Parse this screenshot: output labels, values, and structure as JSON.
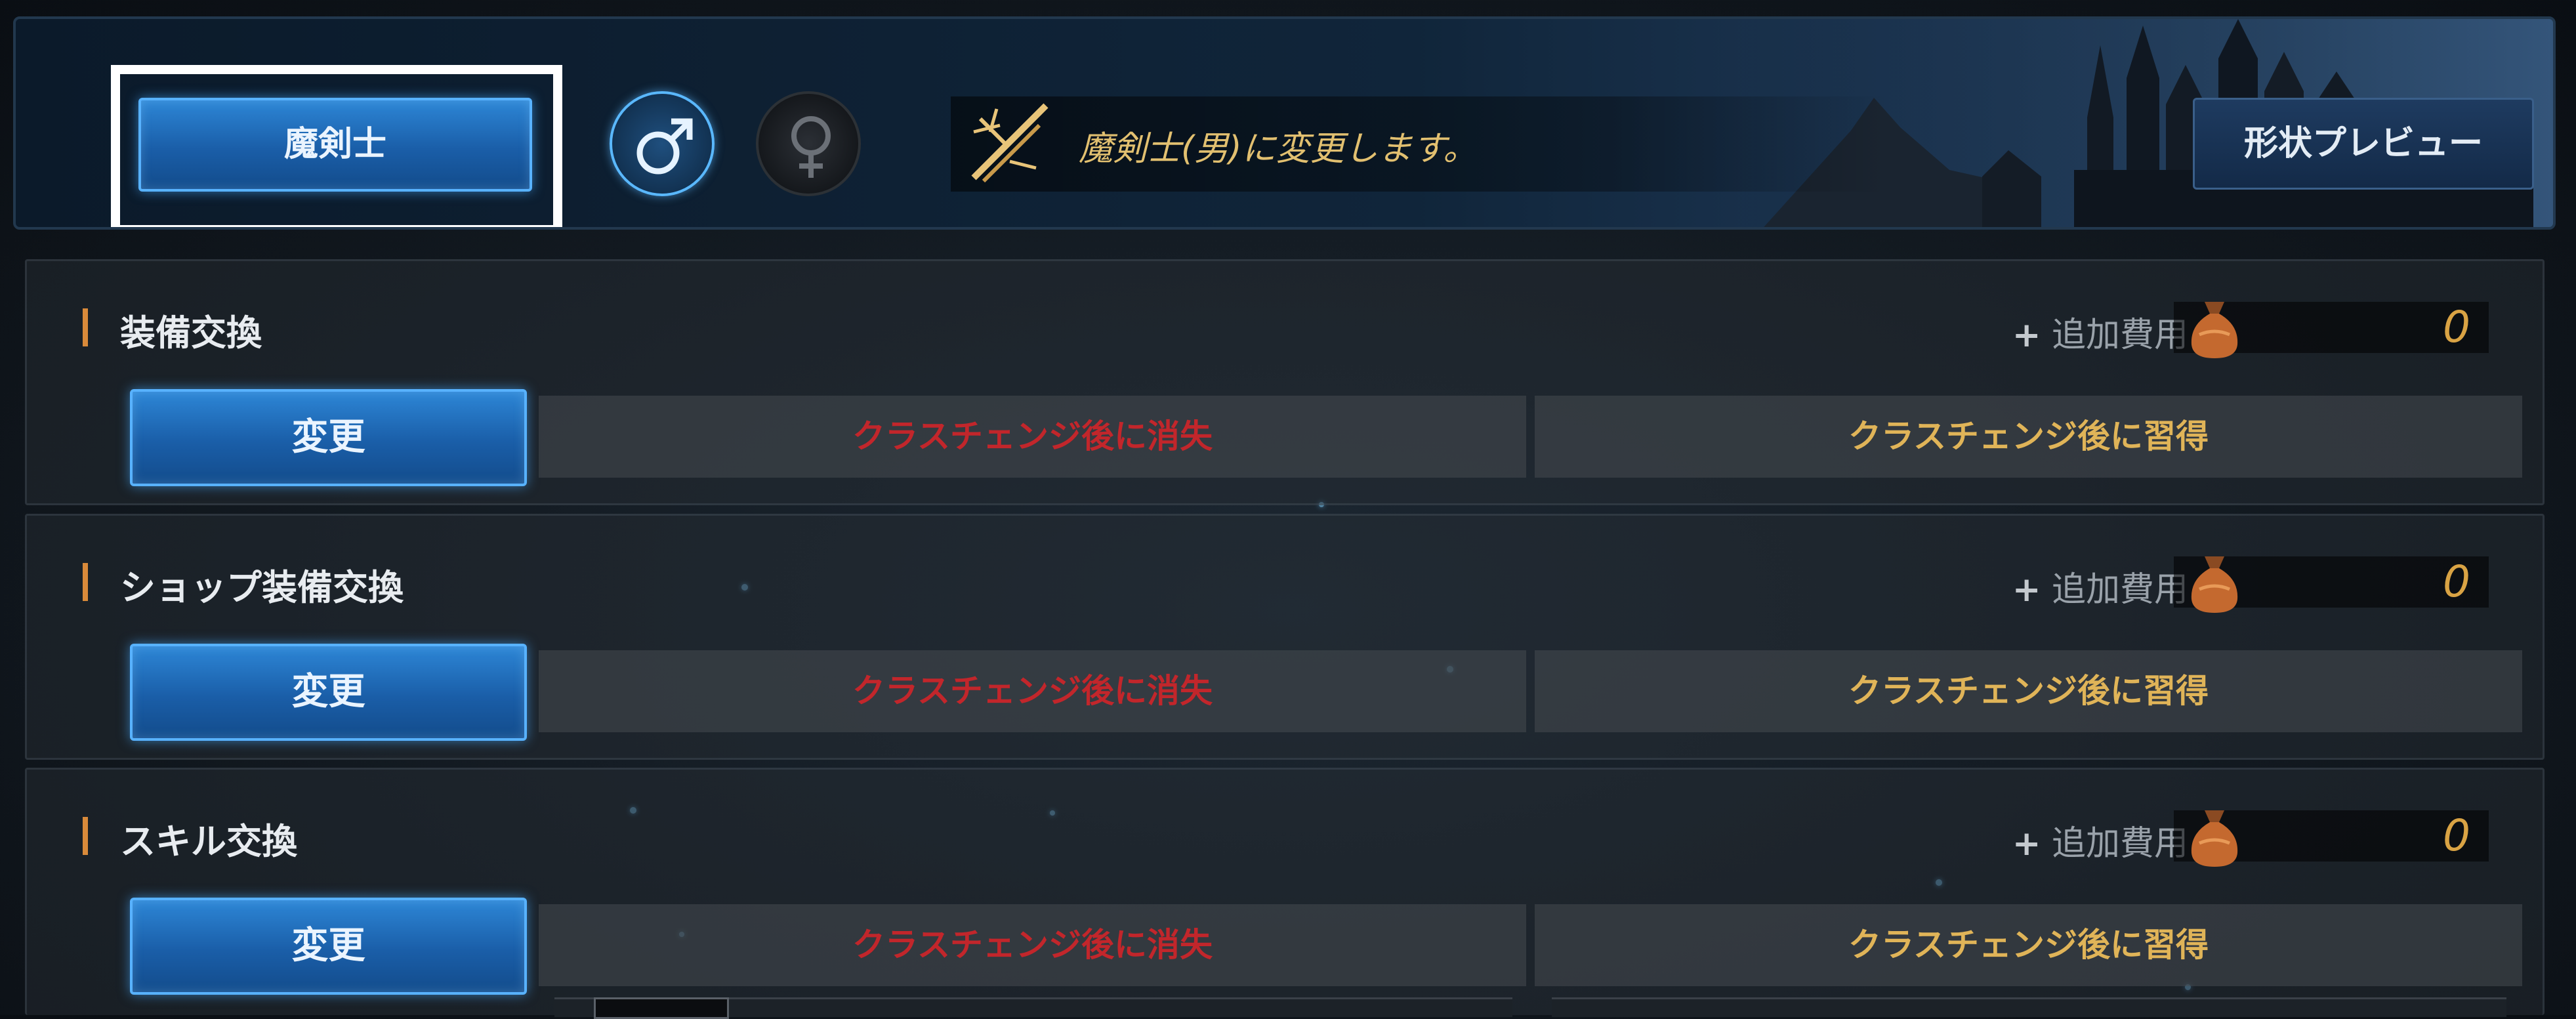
{
  "header": {
    "class_button": "魔剣士",
    "male_icon": "male-symbol-icon",
    "female_icon": "female-symbol-icon",
    "info_icon": "crossed-swords-icon",
    "info_text": "魔剣士(男)に変更します。",
    "preview_button": "形状プレビュー"
  },
  "sections": [
    {
      "title": "装備交換",
      "cost_plus": "+",
      "cost_label": "追加費用",
      "cost_value": "0",
      "change_button": "変更",
      "lose_text": "クラスチェンジ後に消失",
      "learn_text": "クラスチェンジ後に習得"
    },
    {
      "title": "ショップ装備交換",
      "cost_plus": "+",
      "cost_label": "追加費用",
      "cost_value": "0",
      "change_button": "変更",
      "lose_text": "クラスチェンジ後に消失",
      "learn_text": "クラスチェンジ後に習得"
    },
    {
      "title": "スキル交換",
      "cost_plus": "+",
      "cost_label": "追加費用",
      "cost_value": "0",
      "change_button": "変更",
      "lose_text": "クラスチェンジ後に消失",
      "learn_text": "クラスチェンジ後に習得"
    }
  ],
  "colors": {
    "accent_blue": "#2d86d6",
    "lose_red": "#c2262b",
    "learn_gold": "#e0b458",
    "cost_gold": "#d9a344",
    "section_accent": "#d98a3a"
  }
}
